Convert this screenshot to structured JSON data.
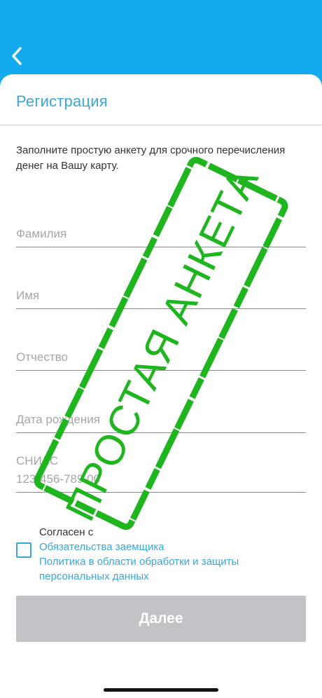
{
  "header": {
    "back_icon": "chevron-left-icon"
  },
  "page": {
    "title": "Регистрация",
    "intro": "Заполните простую анкету для срочного перечисления денег на Вашу карту."
  },
  "form": {
    "last_name_placeholder": "Фамилия",
    "first_name_placeholder": "Имя",
    "patronymic_placeholder": "Отчество",
    "birth_date_placeholder": "Дата рождения",
    "snils_label": "СНИЛС",
    "snils_placeholder": "123-456-789 00"
  },
  "agreement": {
    "label": "Согласен с",
    "link_obligations": "Обязательства заемщика",
    "link_policy": "Политика в области обработки и защиты персональных данных",
    "checked": false
  },
  "actions": {
    "next_label": "Далее"
  },
  "stamp": {
    "text": "ПРОСТАЯ АНКЕТА",
    "color": "#1fb51f"
  },
  "colors": {
    "accent": "#3aa7db",
    "header": "#13aaee",
    "button_disabled": "#c2c2c7"
  }
}
